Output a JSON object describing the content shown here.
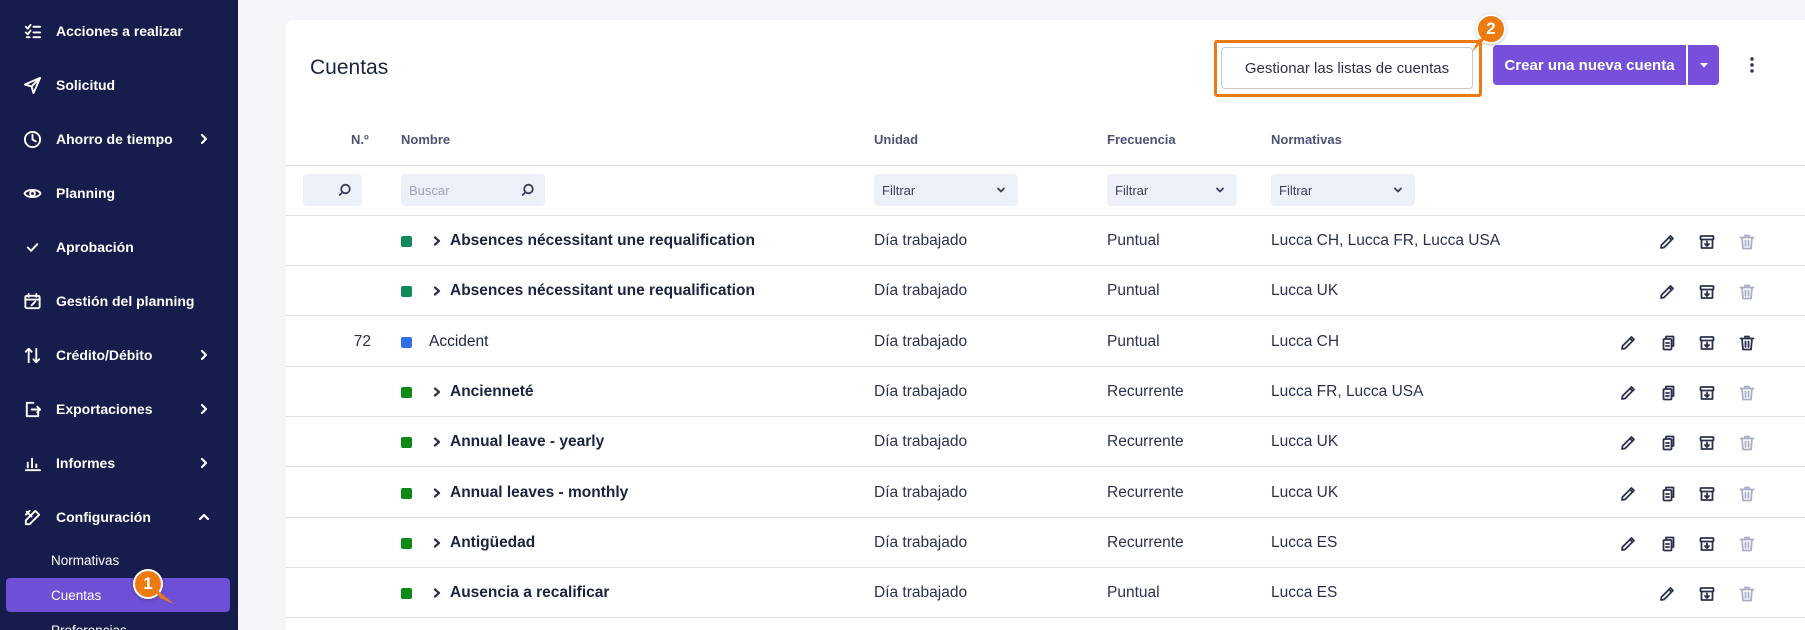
{
  "sidebar": {
    "items": [
      {
        "label": "Acciones a realizar",
        "icon": "tasks-list-icon"
      },
      {
        "label": "Solicitud",
        "icon": "paper-plane-icon"
      },
      {
        "label": "Ahorro de tiempo",
        "icon": "clock-icon",
        "expand": "chevron-right"
      },
      {
        "label": "Planning",
        "icon": "eye-icon"
      },
      {
        "label": "Aprobación",
        "icon": "checkmark-icon"
      },
      {
        "label": "Gestión del planning",
        "icon": "calendar-edit-icon"
      },
      {
        "label": "Crédito/Débito",
        "icon": "up-down-arrows-icon",
        "expand": "chevron-right"
      },
      {
        "label": "Exportaciones",
        "icon": "export-icon",
        "expand": "chevron-right"
      },
      {
        "label": "Informes",
        "icon": "bar-chart-icon",
        "expand": "chevron-right"
      },
      {
        "label": "Configuración",
        "icon": "tools-icon",
        "expand": "chevron-up"
      }
    ],
    "subitems": [
      {
        "label": "Normativas",
        "active": false
      },
      {
        "label": "Cuentas",
        "active": true
      },
      {
        "label": "Preferencias",
        "active": false
      }
    ],
    "colors": {
      "background": "#161d4c",
      "active": "#6d50d6"
    }
  },
  "page": {
    "title": "Cuentas",
    "manage_button": "Gestionar las listas de cuentas",
    "create_button": "Crear una nueva cuenta",
    "accent_color": "#7650db"
  },
  "table": {
    "headers": {
      "num": "N.º",
      "name": "Nombre",
      "unit": "Unidad",
      "frequency": "Frecuencia",
      "rules": "Normativas"
    },
    "filters": {
      "search_placeholder": "Buscar",
      "unit": "Filtrar",
      "frequency": "Filtrar",
      "rules": "Filtrar"
    },
    "rows": [
      {
        "num": "",
        "color": "#0f8a5a",
        "group": true,
        "name": "Absences nécessitant une requalification",
        "unit": "Día trabajado",
        "frequency": "Puntual",
        "rules": "Lucca CH, Lucca FR, Lucca USA",
        "actions": [
          "edit",
          "archive",
          "delete-disabled"
        ]
      },
      {
        "num": "",
        "color": "#0f8a5a",
        "group": true,
        "name": "Absences nécessitant une requalification",
        "unit": "Día trabajado",
        "frequency": "Puntual",
        "rules": "Lucca UK",
        "actions": [
          "edit",
          "archive",
          "delete-disabled"
        ]
      },
      {
        "num": "72",
        "color": "#2f6fe8",
        "group": false,
        "name": "Accident",
        "unit": "Día trabajado",
        "frequency": "Puntual",
        "rules": "Lucca CH",
        "actions": [
          "edit",
          "copy",
          "archive",
          "delete"
        ]
      },
      {
        "num": "",
        "color": "#0d8a16",
        "group": true,
        "name": "Ancienneté",
        "unit": "Día trabajado",
        "frequency": "Recurrente",
        "rules": "Lucca FR, Lucca USA",
        "actions": [
          "edit",
          "copy",
          "archive",
          "delete-disabled"
        ]
      },
      {
        "num": "",
        "color": "#0d8a16",
        "group": true,
        "name": "Annual leave - yearly",
        "unit": "Día trabajado",
        "frequency": "Recurrente",
        "rules": "Lucca UK",
        "actions": [
          "edit",
          "copy",
          "archive",
          "delete-disabled"
        ]
      },
      {
        "num": "",
        "color": "#0d8a16",
        "group": true,
        "name": "Annual leaves - monthly",
        "unit": "Día trabajado",
        "frequency": "Recurrente",
        "rules": "Lucca UK",
        "actions": [
          "edit",
          "copy",
          "archive",
          "delete-disabled"
        ]
      },
      {
        "num": "",
        "color": "#0d8a16",
        "group": true,
        "name": "Antigüedad",
        "unit": "Día trabajado",
        "frequency": "Recurrente",
        "rules": "Lucca ES",
        "actions": [
          "edit",
          "copy",
          "archive",
          "delete-disabled"
        ]
      },
      {
        "num": "",
        "color": "#0d8a16",
        "group": true,
        "name": "Ausencia a recalificar",
        "unit": "Día trabajado",
        "frequency": "Puntual",
        "rules": "Lucca ES",
        "actions": [
          "edit",
          "archive",
          "delete-disabled"
        ]
      }
    ]
  },
  "annotations": {
    "step1": "1",
    "step2": "2",
    "color": "#ed7b10"
  }
}
